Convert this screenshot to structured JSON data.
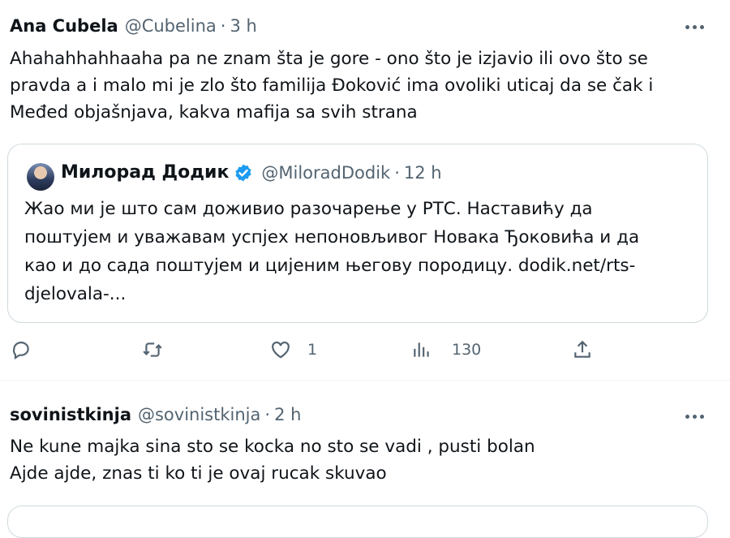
{
  "tweet1": {
    "name": "Ana Cubela",
    "handle": "@Cubelina",
    "separator": "·",
    "time": "3 h",
    "more_icon": "more-horizontal-icon",
    "text_lines": [
      "Ahahahhahhaaha pa ne znam šta je gore - ono što je izjavio ili ovo što se",
      "pravda a i malo mi je zlo što familija Đoković ima ovoliki uticaj da se čak i",
      "Međed objašnjava, kakva mafija sa svih strana"
    ],
    "quote": {
      "name": "Милорад Додик",
      "verified_icon": "verified-badge-icon",
      "verified_color": "#1d9bf0",
      "handle": "@MiloradDodik",
      "separator": "·",
      "time": "12 h",
      "text_lines": [
        "Жао ми је што сам доживио разочарење у РТС. Наставићу да",
        "поштујем и уважавам успјех непоновљивог Новака Ђоковића и да",
        "као и до сада поштујем и цијеним његову породицу. dodik.net/rts-",
        "djelovala-..."
      ]
    },
    "actions": {
      "reply_icon": "reply-icon",
      "retweet_icon": "retweet-icon",
      "like_icon": "heart-icon",
      "like_count": "1",
      "views_icon": "analytics-icon",
      "views_count": "130",
      "share_icon": "share-icon"
    }
  },
  "tweet2": {
    "name": "sovinistkinja",
    "handle": "@sovinistkinja",
    "separator": "·",
    "time": "2 h",
    "more_icon": "more-horizontal-icon",
    "text_lines": [
      "Ne kune majka sina sto se kocka no sto se vadi , pusti bolan",
      "Ajde ajde, znas ti ko ti je ovaj rucak skuvao"
    ]
  },
  "colors": {
    "text": "#0f1419",
    "secondary": "#536471",
    "border": "#cfd9de",
    "divider": "#eff3f4",
    "verified": "#1d9bf0"
  }
}
